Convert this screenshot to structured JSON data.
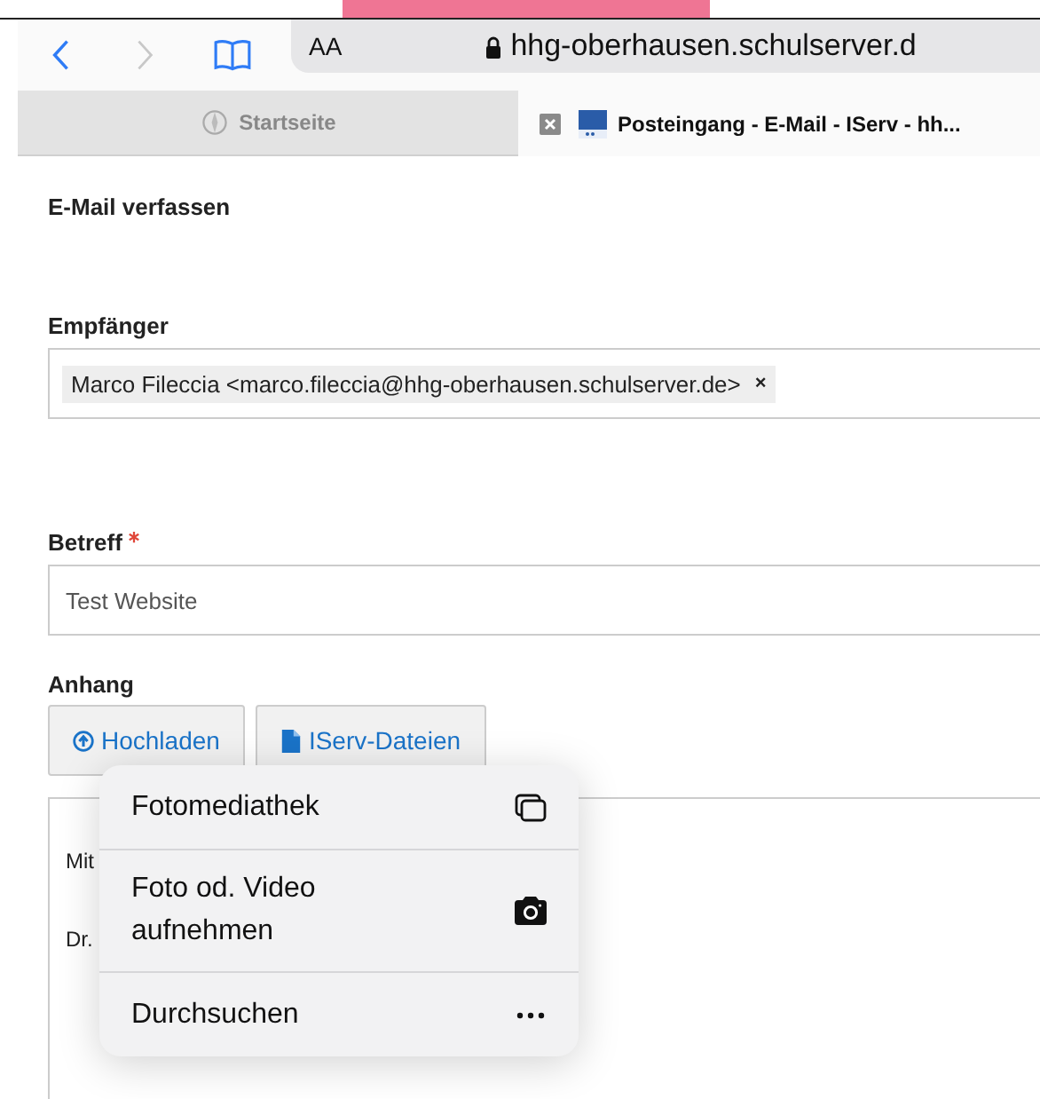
{
  "browser": {
    "address_size_label": "AA",
    "url": "hhg-oberhausen.schulserver.d"
  },
  "tabs": [
    {
      "label": "Startseite",
      "selected": false
    },
    {
      "label": "Posteingang - E-Mail - IServ - hh...",
      "selected": true
    }
  ],
  "page": {
    "title": "E-Mail verfassen",
    "recipient_label": "Empfänger",
    "recipients": [
      {
        "text": "Marco Fileccia <marco.fileccia@hhg-oberhausen.schulserver.de>",
        "remove": "×"
      }
    ],
    "subject_label": "Betreff",
    "subject_required": true,
    "subject_value": "Test Website",
    "attachment_label": "Anhang",
    "attachment_buttons": [
      {
        "label": "Hochladen",
        "kind": "upload"
      },
      {
        "label": "IServ-Dateien",
        "kind": "file"
      }
    ],
    "editor_lines": [
      "Mit",
      "Dr."
    ]
  },
  "popup_menu": [
    {
      "label": "Fotomediathek",
      "kind": "library"
    },
    {
      "label": "Foto od. Video\naufnehmen",
      "kind": "camera"
    },
    {
      "label": "Durchsuchen",
      "kind": "more"
    }
  ]
}
